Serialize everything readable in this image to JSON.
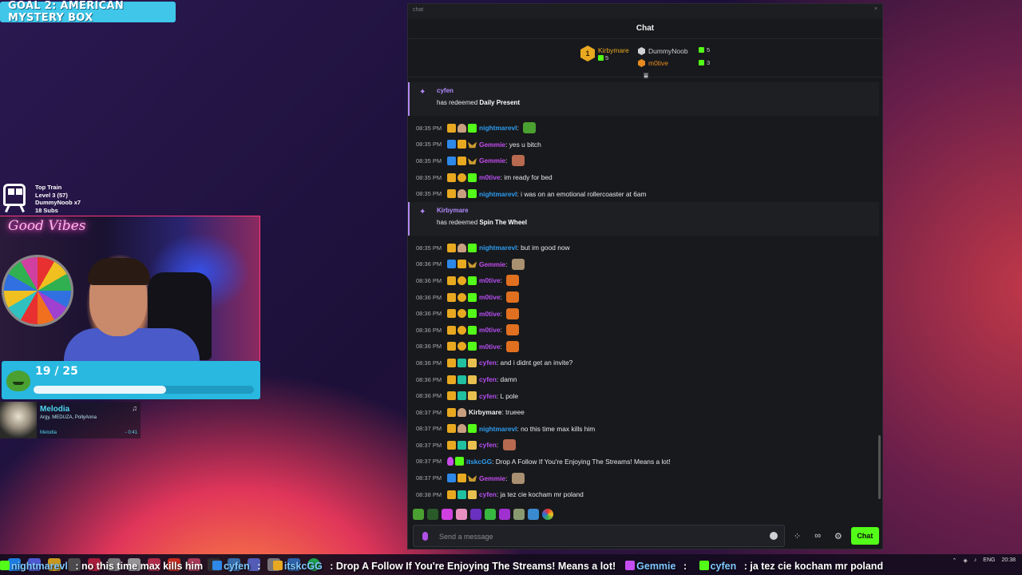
{
  "overlay": {
    "goal_banner": "GOAL 2: AMERICAN MYSTERY BOX",
    "train": {
      "title": "Top Train",
      "level": "Level 3 (57)",
      "user": "DummyNoob x7",
      "subs": "18 Subs"
    },
    "webcam_sign": "Good Vibes",
    "sub_goal": {
      "count": "19 / 25",
      "progress": 0.6
    },
    "music": {
      "title": "Melodia",
      "artists": "Argy, MEDUZA, PollyAnna",
      "album": "Melodia",
      "time": "- 0:41"
    }
  },
  "chat": {
    "window_title": "chat",
    "close_label": "×",
    "header": "Chat",
    "leaderboard": [
      {
        "rank": "1",
        "name": "Kirbymare",
        "gifts": "5",
        "color": "#e8a820"
      },
      {
        "rank": "2",
        "name": "DummyNoob",
        "gifts": "5",
        "color": "#cfd0d4"
      },
      {
        "rank": "3",
        "name": "m0tive",
        "gifts": "3",
        "color": "#e88a20"
      }
    ],
    "redeems": [
      {
        "user": "cyfen",
        "prefix": "has redeemed ",
        "reward": "Daily Present"
      },
      {
        "user": "Kirbymare",
        "prefix": "has redeemed ",
        "reward": "Spin The Wheel"
      }
    ],
    "messages": [
      {
        "time": "08:35 PM",
        "user": "nightmarevl",
        "color": "#2d9cf0",
        "text": ""
      },
      {
        "time": "08:35 PM",
        "user": "Gemmie",
        "color": "#c44ef0",
        "text": "yes u bitch"
      },
      {
        "time": "08:35 PM",
        "user": "Gemmie",
        "color": "#c44ef0",
        "text": ""
      },
      {
        "time": "08:35 PM",
        "user": "m0tive",
        "color": "#b44ef0",
        "text": "im ready for bed"
      },
      {
        "time": "08:35 PM",
        "user": "nightmarevl",
        "color": "#2d9cf0",
        "text": "i was on an emotional rollercoaster at 6am"
      },
      {
        "time": "08:35 PM",
        "user": "nightmarevl",
        "color": "#2d9cf0",
        "text": "but im good now"
      },
      {
        "time": "08:36 PM",
        "user": "Gemmie",
        "color": "#c44ef0",
        "text": ""
      },
      {
        "time": "08:36 PM",
        "user": "m0tive",
        "color": "#b44ef0",
        "text": ""
      },
      {
        "time": "08:36 PM",
        "user": "m0tive",
        "color": "#b44ef0",
        "text": ""
      },
      {
        "time": "08:36 PM",
        "user": "m0tive",
        "color": "#b44ef0",
        "text": ""
      },
      {
        "time": "08:36 PM",
        "user": "m0tive",
        "color": "#b44ef0",
        "text": ""
      },
      {
        "time": "08:36 PM",
        "user": "m0tive",
        "color": "#b44ef0",
        "text": ""
      },
      {
        "time": "08:36 PM",
        "user": "cyfen",
        "color": "#b44ef0",
        "text": "and i didnt get an invite?"
      },
      {
        "time": "08:36 PM",
        "user": "cyfen",
        "color": "#b44ef0",
        "text": "damn"
      },
      {
        "time": "08:36 PM",
        "user": "cyfen",
        "color": "#b44ef0",
        "text": "L pole"
      },
      {
        "time": "08:37 PM",
        "user": "Kirbymare",
        "color": "#f0f0f0",
        "text": "trueee"
      },
      {
        "time": "08:37 PM",
        "user": "nightmarevl",
        "color": "#2d9cf0",
        "text": "no this time max kills him"
      },
      {
        "time": "08:37 PM",
        "user": "cyfen",
        "color": "#b44ef0",
        "text": ""
      },
      {
        "time": "08:37 PM",
        "user": "itskcGG",
        "color": "#2d9cf0",
        "text": "Drop A Follow If You're Enjoying The Streams! Means a lot!"
      },
      {
        "time": "08:37 PM",
        "user": "Gemmie",
        "color": "#c44ef0",
        "text": ""
      },
      {
        "time": "08:38 PM",
        "user": "cyfen",
        "color": "#b44ef0",
        "text": "ja tez cie kocham mr poland"
      }
    ],
    "input_placeholder": "Send a message",
    "send_label": "Chat"
  },
  "ticker": [
    {
      "user": "nightmarevl",
      "text": "no this time max kills him"
    },
    {
      "user": "cyfen",
      "text": ""
    },
    {
      "user": "itskcGG",
      "text": "Drop A Follow If You're Enjoying The Streams! Means a lot!"
    },
    {
      "user": "Gemmie",
      "text": ""
    },
    {
      "user": "cyfen",
      "text": "ja tez cie kocham mr poland"
    }
  ],
  "taskbar": {
    "lang": "ENG",
    "time": "20:38"
  }
}
